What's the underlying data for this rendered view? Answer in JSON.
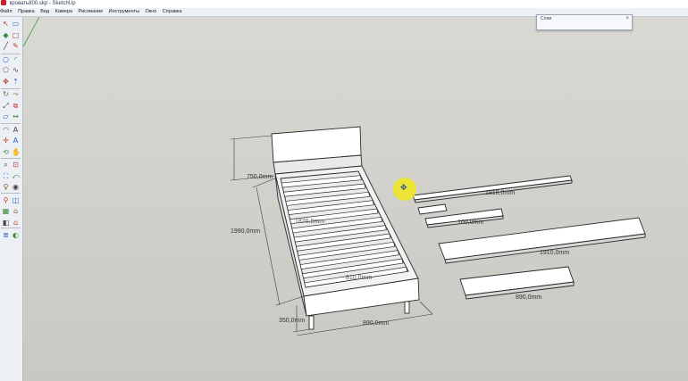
{
  "window": {
    "title": "кровать800.skp - SketchUp"
  },
  "menu": [
    "Файл",
    "Правка",
    "Вид",
    "Камера",
    "Рисование",
    "Инструменты",
    "Окно",
    "Справка"
  ],
  "tools": [
    "select-icon",
    "eraser-icon",
    "paint-bucket-icon",
    "rectangle-icon",
    "line-icon",
    "pencil-icon",
    "circle-icon",
    "arc-icon",
    "polygon-icon",
    "freehand-icon",
    "move-icon",
    "push-pull-icon",
    "rotate-icon",
    "follow-me-icon",
    "scale-icon",
    "offset-icon",
    "tape-measure-icon",
    "dimension-icon",
    "protractor-icon",
    "text-icon",
    "axes-icon",
    "3d-text-icon",
    "orbit-icon",
    "pan-icon",
    "zoom-icon",
    "zoom-window-icon",
    "zoom-extents-icon",
    "previous-view-icon",
    "position-camera-icon",
    "look-around-icon",
    "walk-icon",
    "section-plane-icon",
    "components-icon",
    "warehouse-icon",
    "extension-icon",
    "house-icon",
    "layers-icon",
    "styles-icon"
  ],
  "layers_panel": {
    "title": "Слои"
  },
  "dimensions": {
    "headboard_height": "750,0mm",
    "bed_length": "1990,0mm",
    "leg_height": "350,0mm",
    "bed_width": "890,0mm",
    "inner_length": "1870,0mm",
    "inner_width": "810,0mm",
    "long_rail": "1910,0mm",
    "short_piece": "100,0mm",
    "side_board": "1910,0mm",
    "end_board": "890,0mm"
  }
}
